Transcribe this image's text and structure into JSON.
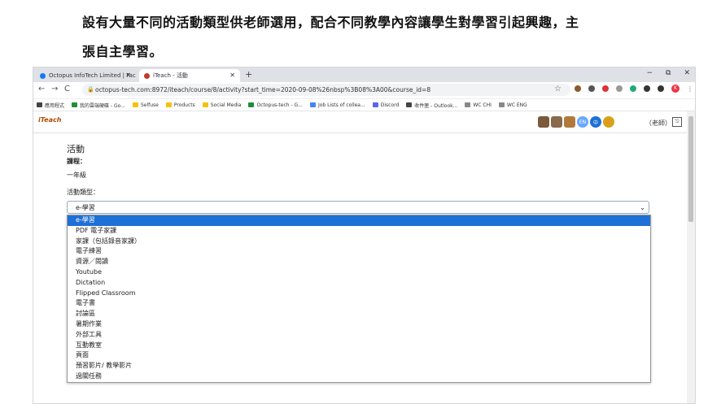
{
  "caption": {
    "line1": "設有大量不同的活動類型供老師選用，配合不同教學內容讓學生對學習引起興趣，主",
    "line2": "張自主學習。"
  },
  "browser": {
    "tabs": [
      {
        "title": "Octopus InfoTech Limited | Fac",
        "favicon_color": "#1877f2"
      },
      {
        "title": "iTeach - 活動",
        "favicon_color": "#c0392b"
      }
    ],
    "new_tab": "+",
    "window_controls": {
      "minimize": "−",
      "maximize": "⧉",
      "close": "✕"
    },
    "nav": {
      "back": "←",
      "forward": "→",
      "reload": "C"
    },
    "url": "octopus-tech.com:8972/iteach/course/8/activity?start_time=2020-09-08%26nbsp%3B08%3A00&course_id=8",
    "star": "☆",
    "profile_initial": "K",
    "bookmarks": [
      {
        "label": "應用程式",
        "color": "#444"
      },
      {
        "label": "我的雲端硬碟 - Go...",
        "color": "#1e8e3e"
      },
      {
        "label": "Selfuse",
        "color": "#f4c20d"
      },
      {
        "label": "Products",
        "color": "#f4c20d"
      },
      {
        "label": "Social Media",
        "color": "#f4c20d"
      },
      {
        "label": "Octopus-tech - G...",
        "color": "#1e8e3e"
      },
      {
        "label": "Job Lists of collea...",
        "color": "#4285f4"
      },
      {
        "label": "Discord",
        "color": "#5865f2"
      },
      {
        "label": "收件匣 - Outlook...",
        "color": "#444"
      },
      {
        "label": "WC CHI",
        "color": "#888"
      },
      {
        "label": "WC ENG",
        "color": "#888"
      }
    ]
  },
  "app": {
    "logo": "iTeach",
    "lang_en": "EN",
    "lang_zh": "中",
    "role": "（老師）",
    "page_title": "活動",
    "course_label": "課程：",
    "course_value": "一年級",
    "type_label": "活動類型：",
    "selected_type": "e-學習",
    "options": [
      "e-學習",
      "PDF 電子家課",
      "家課（包括錄音家課）",
      "電子練習",
      "資源／閱讀",
      "Youtube",
      "Dictation",
      "Flipped Classroom",
      "電子書",
      "討論區",
      "暑期作業",
      "外部工具",
      "互動教室",
      "頁面",
      "預習影片/ 教學影片",
      "過關任務"
    ]
  },
  "colors": {
    "selected_option": "#1e70d6",
    "tab_bar": "#dee1e6"
  }
}
